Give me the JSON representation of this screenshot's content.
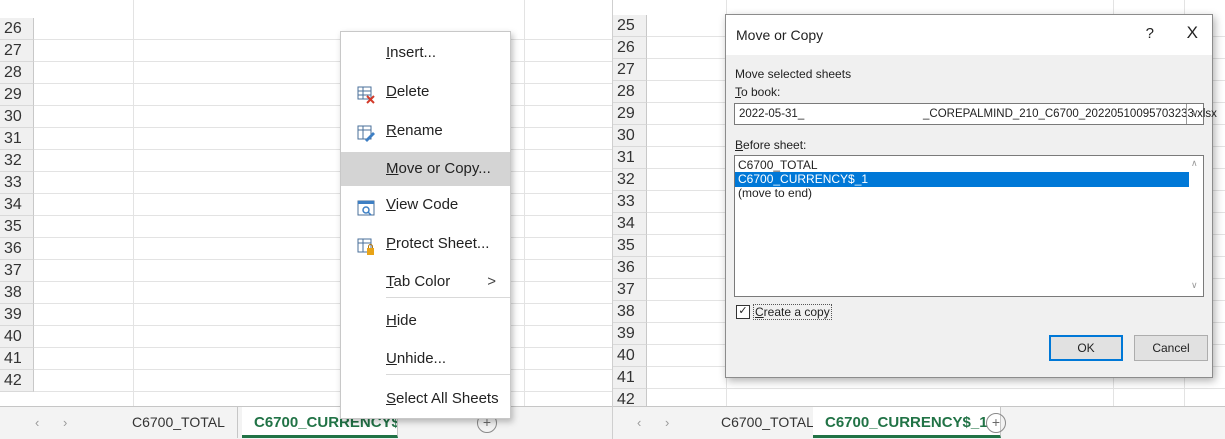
{
  "left_pane": {
    "rows": [
      "26",
      "27",
      "28",
      "29",
      "30",
      "31",
      "32",
      "33",
      "34",
      "35",
      "36",
      "37",
      "38",
      "39",
      "40",
      "41",
      "42"
    ],
    "tabs": [
      "C6700_TOTAL",
      "C6700_CURRENCY$_1"
    ],
    "active_tab": "C6700_CURRENCY$_1"
  },
  "context_menu": {
    "items": [
      {
        "pre": "",
        "ul": "I",
        "post": "nsert...",
        "icon": ""
      },
      {
        "pre": "",
        "ul": "D",
        "post": "elete",
        "icon": "delete-sheet-icon"
      },
      {
        "pre": "",
        "ul": "R",
        "post": "ename",
        "icon": "rename-sheet-icon"
      },
      {
        "pre": "",
        "ul": "M",
        "post": "ove or Copy...",
        "icon": ""
      },
      {
        "pre": "",
        "ul": "V",
        "post": "iew Code",
        "icon": "view-code-icon"
      },
      {
        "pre": "",
        "ul": "P",
        "post": "rotect Sheet...",
        "icon": "protect-sheet-icon"
      },
      {
        "pre": "",
        "ul": "T",
        "post": "ab Color",
        "icon": ""
      },
      {
        "pre": "",
        "ul": "H",
        "post": "ide",
        "icon": ""
      },
      {
        "pre": "",
        "ul": "U",
        "post": "nhide...",
        "icon": ""
      },
      {
        "pre": "",
        "ul": "S",
        "post": "elect All Sheets",
        "icon": ""
      }
    ],
    "highlighted_index": 3,
    "submenu_arrow": ">"
  },
  "right_pane": {
    "rows": [
      "25",
      "26",
      "27",
      "28",
      "29",
      "30",
      "31",
      "32",
      "33",
      "34",
      "35",
      "36",
      "37",
      "38",
      "39",
      "40",
      "41",
      "42"
    ],
    "tabs": [
      "C6700_TOTAL",
      "C6700_CURRENCY$_1"
    ],
    "active_tab": "C6700_CURRENCY$_1"
  },
  "dialog": {
    "title": "Move or Copy",
    "help": "?",
    "close": "X",
    "move_selected": "Move selected sheets",
    "to_book_label_ul": "T",
    "to_book_label_rest": "o book:",
    "book_value_left": "2022-05-31_",
    "book_value_right": "_COREPALMIND_210_C6700_20220510095703233.xlsx",
    "before_sheet_label_ul": "B",
    "before_sheet_label_rest": "efore sheet:",
    "sheets": [
      "C6700_TOTAL",
      "C6700_CURRENCY$_1",
      "(move to end)"
    ],
    "selected_sheet_index": 1,
    "create_copy_ul": "C",
    "create_copy_rest": "reate a copy",
    "create_copy_checked": true,
    "ok": "OK",
    "cancel": "Cancel"
  },
  "icons": {
    "nav_prev": "◀",
    "nav_next": "▶",
    "add_sheet": "+",
    "check_mark": "✓",
    "dropdown": "⌄"
  },
  "colors": {
    "excel_green": "#217346",
    "selection_blue": "#0078d7",
    "menu_highlight": "#d4d4d4"
  }
}
